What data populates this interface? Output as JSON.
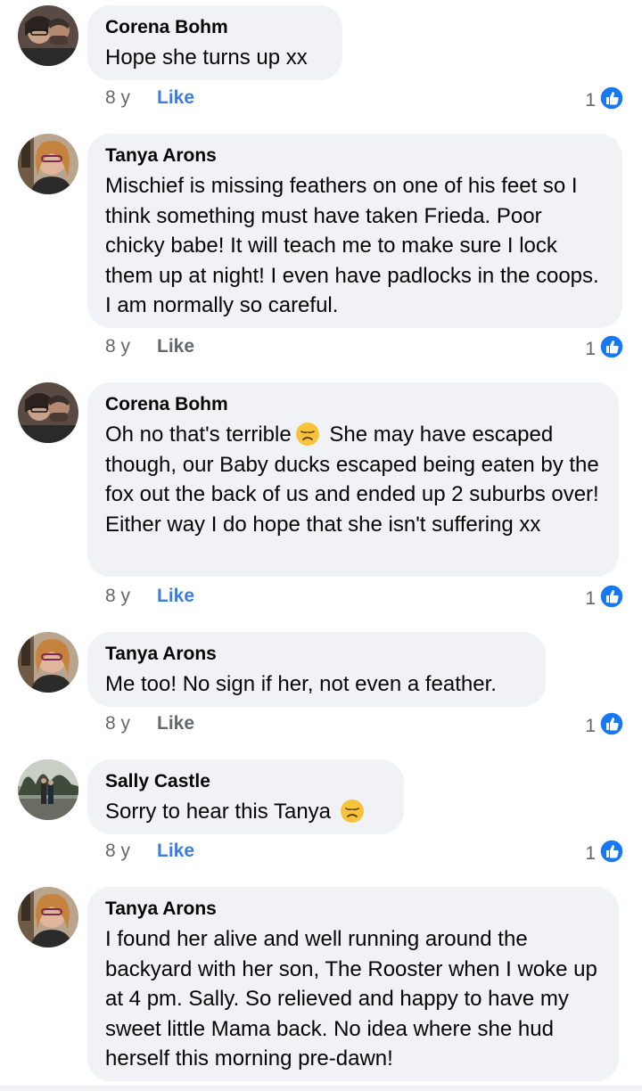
{
  "comments": [
    {
      "author": "Corena Bohm",
      "text_parts": [
        "Hope she turns up xx"
      ],
      "time": "8 y",
      "like_label": "Like",
      "like_active": true,
      "reaction_count": "1",
      "reaction_icon": "thumbs-up-icon"
    },
    {
      "author": "Tanya Arons",
      "text_parts": [
        "Mischief is missing feathers on one of his feet so I think something must have taken Frieda.  Poor chicky babe!  It will teach me to make sure I lock them up at night!  I even have padlocks in the coops.  I am normally so careful."
      ],
      "time": "8 y",
      "like_label": "Like",
      "like_active": false,
      "reaction_count": "1",
      "reaction_icon": "thumbs-up-icon"
    },
    {
      "author": "Corena Bohm",
      "text_parts": [
        "Oh no that's terrible",
        "She may have escaped though, our Baby ducks escaped being eaten by the fox out the back of us and ended up 2 suburbs over! Either way I do hope that she isn't suffering xx"
      ],
      "emoji": "disappointed-face-emoji",
      "time": "8 y",
      "like_label": "Like",
      "like_active": true,
      "reaction_count": "1",
      "reaction_icon": "thumbs-up-icon"
    },
    {
      "author": "Tanya Arons",
      "text_parts": [
        "Me too! No sign if her, not even a feather."
      ],
      "time": "8 y",
      "like_label": "Like",
      "like_active": false,
      "reaction_count": "1",
      "reaction_icon": "thumbs-up-icon"
    },
    {
      "author": "Sally Castle",
      "text_parts": [
        "Sorry to hear this Tanya"
      ],
      "emoji": "disappointed-face-emoji",
      "time": "8 y",
      "like_label": "Like",
      "like_active": true,
      "reaction_count": "1",
      "reaction_icon": "thumbs-up-icon"
    },
    {
      "author": "Tanya Arons",
      "text_parts": [
        "I found her alive and well running around the backyard with her son, The Rooster when I woke up at 4 pm.  Sally.   So relieved and happy to have my sweet little Mama back.  No idea where she hud herself this morning pre-dawn!"
      ]
    }
  ],
  "colors": {
    "bubble": "#f0f2f5",
    "like_active": "#3b7ddd",
    "meta": "#65676b",
    "reaction_blue": "#1877f2"
  }
}
